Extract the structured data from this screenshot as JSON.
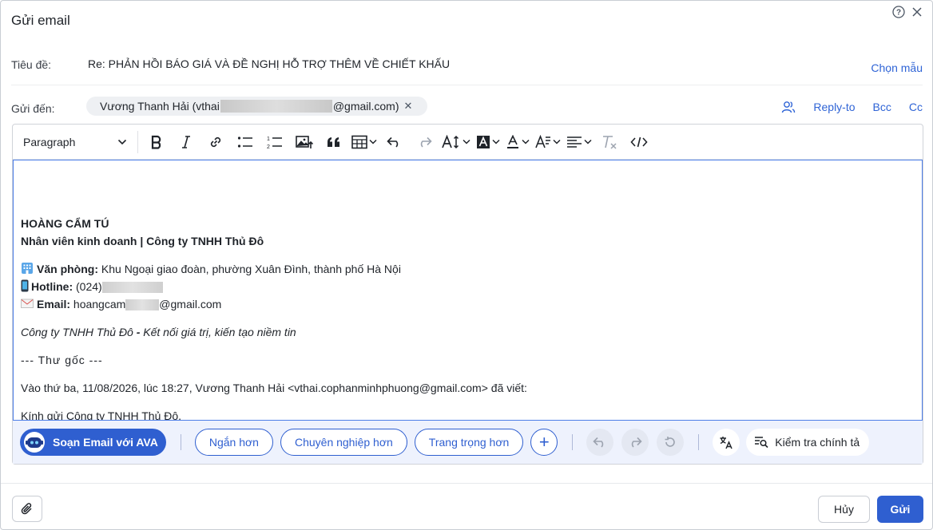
{
  "dialog": {
    "title": "Gửi email"
  },
  "subject": {
    "label": "Tiêu đề:",
    "value": "Re: PHẢN HỒI BÁO GIÁ VÀ ĐỀ NGHỊ HỖ TRỢ THÊM VỀ CHIẾT KHẤU",
    "template_link": "Chọn mẫu"
  },
  "recipients": {
    "label": "Gửi đến:",
    "chip_prefix": "Vương Thanh Hải (vthai",
    "chip_suffix": "@gmail.com)",
    "reply_to": "Reply-to",
    "bcc": "Bcc",
    "cc": "Cc"
  },
  "toolbar": {
    "paragraph_select": "Paragraph",
    "icons": [
      "bold-icon",
      "italic-icon",
      "link-icon",
      "bullet-list-icon",
      "numbered-list-icon",
      "image-icon",
      "quote-icon",
      "table-icon",
      "undo-icon",
      "redo-icon",
      "font-size-icon",
      "highlight-icon",
      "font-color-icon",
      "text-style-icon",
      "align-icon",
      "clear-format-icon",
      "code-icon"
    ]
  },
  "body": {
    "signature_name": "HOÀNG CẨM TÚ",
    "signature_title": "Nhân viên kinh doanh | Công ty TNHH Thủ Đô",
    "office_label": "Văn phòng:",
    "office_value": "Khu Ngoại giao đoàn, phường Xuân Đình, thành phố Hà Nội",
    "hotline_label": "Hotline:",
    "hotline_value": "(024)",
    "email_label": "Email:",
    "email_prefix": "hoangcam",
    "email_suffix": "@gmail.com",
    "slogan_part1": "Công ty TNHH Thủ Đô",
    "slogan_dash": " - ",
    "slogan_part2": "Kết nối giá trị, kiến tạo niềm tin",
    "original_marker": "--- Thư gốc ---",
    "quote_header": "Vào thứ ba, 11/08/2026, lúc 18:27, Vương Thanh Hải  <vthai.cophanminhphuong@gmail.com> đã viết:",
    "greeting": "Kính gửi Công ty TNHH Thủ Đô,"
  },
  "ai_bar": {
    "ava_button": "Soạn Email với AVA",
    "shorter": "Ngắn hơn",
    "professional": "Chuyên nghiệp hơn",
    "formal": "Trang trọng hơn",
    "spell_check": "Kiểm tra chính tả"
  },
  "footer": {
    "cancel": "Hủy",
    "send": "Gửi"
  },
  "colors": {
    "accent": "#2f5fd0",
    "link": "#2f64d6",
    "ai_bar_bg": "#eef2fd"
  }
}
